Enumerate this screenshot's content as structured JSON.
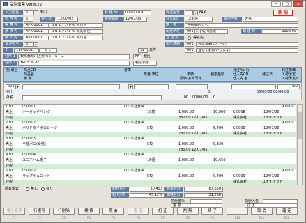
{
  "window": {
    "title": "受注伝票 Ver.8.22",
    "min": "—",
    "max": "□",
    "close": "×"
  },
  "header": {
    "nyuuryoku_tantou": {
      "label": "入力担当",
      "code": "5",
      "dd": "▾",
      "name": "天川"
    },
    "mitsumori_no": {
      "label": "見 積 No",
      "value": "00000019"
    },
    "juchu_kubun": {
      "label": "受注区分",
      "value": "1",
      "dd": "▾",
      "name": "FAX"
    },
    "status_badge": "新 規",
    "tantou": {
      "label": "担 当 者",
      "code": "5"
    },
    "juchu_bi": {
      "label": "受注日",
      "value": "12/07/02"
    },
    "kibou_nouki": {
      "label": "希望納期",
      "value": "12/07/05"
    },
    "chuumon_no": {
      "label": "注文No",
      "value": "12304"
    },
    "gojyouhou": {
      "label": "御担当者",
      "value": "天島"
    },
    "tokuisaki": {
      "label": "得 意 先",
      "code": "AP-00001",
      "name": "ＵＮＩアパレル 荒川区"
    },
    "tekiyou": {
      "label": "摘　要",
      "value": "見積確認です。"
    },
    "seikyuusaki": {
      "label": "請 求 先",
      "code": "AP-00001",
      "name": "ＵＮＩアパレル 株式会社"
    },
    "haisou": {
      "label": "配送予定",
      "value": "001",
      "name": "佐川急便",
      "dd": "▾"
    },
    "haisou_ryou": {
      "label": "配 送 料",
      "value": "9999.99"
    },
    "nounyuusaki": {
      "label": "納 入 先",
      "code": "AP-00001",
      "name": "ＵＮＩアパレル 荒川区"
    },
    "shiharai": {
      "label": "直 送 先",
      "radio_label": "得意先"
    },
    "juchusha": {
      "label": "受注担当",
      "code": "5",
      "dd": "▾"
    },
    "shidou": {
      "label": "指示連絡",
      "value": "001",
      "text": "発送連絡ください。"
    },
    "yuubin": {
      "label": "〒",
      "value": "116-0002",
      "tcl": "ＴＣＬ",
      "ninchi_code": "31",
      "ninchi": "日件"
    },
    "jyuusho1": {
      "label": "住所 1",
      "value": "東京都荒川区荒川５−５−２",
      "tax_kubun": "FF",
      "tax_label": "税区"
    },
    "jyuusho2": {
      "label": "住所 2",
      "value": "YRCビル 8F",
      "tax_label2": "税込表示"
    },
    "shidou2": {
      "value": "001",
      "text": "宜しくお願いします。"
    }
  },
  "grid_header": {
    "c1": "受 取区",
    "c2": "商品CD",
    "c3": "商品名",
    "c4": "備 考",
    "c5": "倉庫",
    "c6": "数量 単位",
    "c7": "単価",
    "c8": "原価 お荷予定",
    "c9": "税抜金額",
    "c10": "発注No-行",
    "c11": "仕入先CD",
    "c12": "仕入先 名",
    "c13": "発注日",
    "c14": "発注単価",
    "c15": "入荷予定",
    "c16": "入荷予定日"
  },
  "input_row": {
    "line": "001",
    "dd": "▾",
    "kubun": "売上",
    "zero": "0",
    "amt": ".00",
    "date": "00/00/00",
    "gai": "外税",
    "cost": ".00",
    "dates": "00/00/00 00/00/00",
    "sub_zero": "0",
    "sub_dash": "00/00/00",
    "amt2": ".00",
    "sub_x": "00/00/00"
  },
  "lines": [
    {
      "no": "1 01",
      "kubun": "売上",
      "tax": "外税",
      "code": "IF-0001",
      "name": "ツータックパンツ",
      "wh": "001 本社倉庫",
      "qty": "10着",
      "price": "1,080.00",
      "cost": "382.00 12/07/05",
      "amt": "10,800",
      "po": "S-0008",
      "po_date": "12/07/26",
      "po_cost": "900.00",
      "supp": "株式会社",
      "supp2": "ユナイテッド"
    },
    {
      "no": "2 01",
      "kubun": "売上",
      "tax": "外税",
      "code": "IF-0002",
      "name": "ボリドライポロシャツ",
      "wh": "001 本社倉庫",
      "qty": "5枚",
      "price": "1,080.00",
      "cost": "780.00 12/07/05",
      "amt": "5,400",
      "po": "S-0009",
      "po_date": "12/07/26",
      "po_cost": "900.00",
      "supp": "株式会社",
      "supp2": "ユナイテッド"
    },
    {
      "no": "3 01",
      "kubun": "売上",
      "tax": "外税",
      "code": "IF-0003",
      "name": "半袖ポロ(女性)",
      "wh": "001 本社倉庫",
      "qty": "5枚",
      "price": "1,080.00",
      "cost": "780.00 12/07/05",
      "amt": "9,330",
      "po": "",
      "po_date": "",
      "po_cost": "",
      "supp": "",
      "supp2": ""
    },
    {
      "no": "4 01",
      "kubun": "売上",
      "tax": "外税",
      "code": "IF-0004",
      "name": "ユニホーム帽子",
      "wh": "001 本社倉庫",
      "qty": "15個",
      "price": "1,080.00",
      "cost": "",
      "amt": "19,650",
      "po": "",
      "po_date": "",
      "po_cost": "",
      "supp": "",
      "supp2": ""
    },
    {
      "no": "5 01",
      "kubun": "売上",
      "tax": "外税",
      "code": "IF-0002",
      "name": "ラップキュロット",
      "wh": "001 本社倉庫",
      "qty": "5枚",
      "price": "1,080.00",
      "cost": "",
      "amt": "0,400",
      "po": "S-0009",
      "po_date": "12/07/26",
      "po_cost": "900.00",
      "supp": "株式会社",
      "supp2": "ユナイテッド"
    }
  ],
  "bottom": {
    "kokyaku_label": "顧客消去",
    "radio_no": "無し",
    "radio_yes": "有り",
    "sum1_label": "粗利合計",
    "sum1": "30,453",
    "sum2_label": "税抜合計",
    "sum2": "67,650",
    "sum3_label": "粗 利 率",
    "sum3": "45.12%",
    "sum4_label": "課税合計",
    "sum4": "31,238",
    "zenkai_label": "前受金％",
    "zenkai_val": "",
    "zenhaisou_label": "前受入金",
    "zenhaisou_val": "",
    "kin_label": "金 額",
    "kin_val": "",
    "tougou_label": "訂 正",
    "tougou_val": ""
  },
  "fkeys": [
    {
      "label": "受注変更",
      "key": "F1",
      "disabled": true
    },
    {
      "label": "行複写",
      "key": "F2",
      "disabled": false
    },
    {
      "label": "行削除",
      "key": "F3",
      "disabled": false
    },
    {
      "label": "検 索",
      "key": "F4",
      "disabled": false
    },
    {
      "label": "照 会",
      "key": "F5",
      "disabled": false
    },
    {
      "label": "取 消",
      "key": "F6",
      "disabled": true
    },
    {
      "label": "訂 正",
      "key": "F7",
      "disabled": false
    },
    {
      "label": "削 除",
      "key": "F8",
      "disabled": false
    },
    {
      "label": "終 了",
      "key": "F9",
      "disabled": false
    },
    {
      "label": "",
      "key": "F10",
      "disabled": true
    },
    {
      "label": "取 消",
      "key": "F11",
      "disabled": false
    },
    {
      "label": "確 定",
      "key": "F12",
      "disabled": false
    }
  ],
  "colors": {
    "label_bg": "#5e7da3",
    "header_bg": "#a9cce4",
    "row_green": "#d3ecd3",
    "badge": "#d02a2a"
  }
}
